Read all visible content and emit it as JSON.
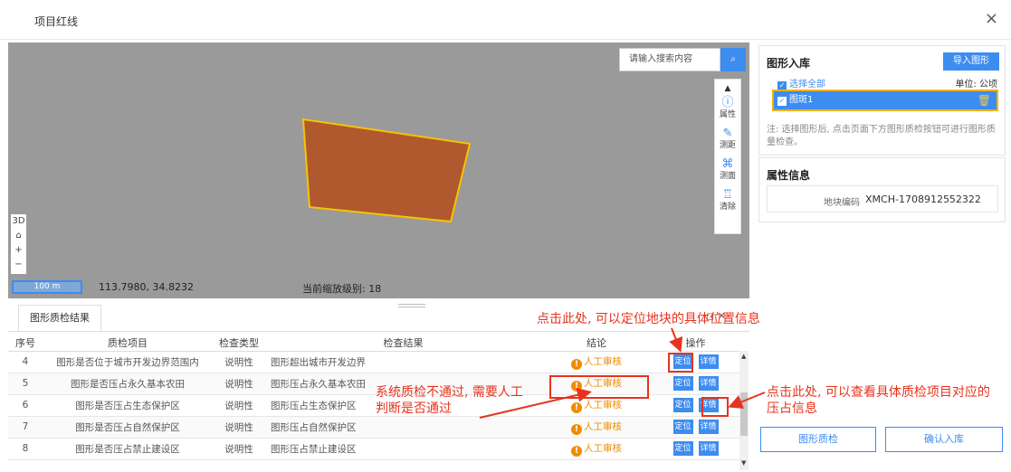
{
  "window": {
    "title": "项目红线",
    "close_label": "×"
  },
  "map": {
    "search_placeholder": "请输入搜索内容",
    "tools": [
      {
        "icon": "info-icon",
        "glyph": "ⓘ",
        "label": "属性"
      },
      {
        "icon": "pencil-icon",
        "glyph": "✎",
        "label": "测距"
      },
      {
        "icon": "area-icon",
        "glyph": "⌘",
        "label": "测面"
      },
      {
        "icon": "clear-icon",
        "glyph": "♖",
        "label": "清除"
      }
    ],
    "nav": {
      "three_d": "3D",
      "home": "🏠",
      "zoom_in": "+",
      "zoom_out": "−"
    },
    "scale_label": "100 m",
    "coordinates": "113.7980, 34.8232",
    "zoom_level_text": "当前缩放级别: 18",
    "polygon_fill": "#b0582e",
    "polygon_stroke": "#f5c400"
  },
  "right_panel": {
    "import_title": "图形入库",
    "import_button": "导入图形",
    "select_all": "选择全部",
    "unit": "单位: 公顷",
    "shape_name": "图斑1",
    "note": "注: 选择图形后, 点击页面下方图形质检按钮可进行图形质量检查。",
    "attr_title": "属性信息",
    "attr_key": "地块编码",
    "attr_value": "XMCH-1708912552322",
    "check_button": "图形质检",
    "confirm_button": "确认入库"
  },
  "bottom": {
    "tab_label": "图形质检结果",
    "columns": [
      "序号",
      "质检项目",
      "检查类型",
      "检查结果",
      "结论",
      "操作"
    ],
    "rows": [
      {
        "no": "4",
        "item": "图形是否位于城市开发边界范围内",
        "type": "说明性",
        "result": "图形超出城市开发边界",
        "conclusion": "人工审核"
      },
      {
        "no": "5",
        "item": "图形是否压占永久基本农田",
        "type": "说明性",
        "result": "图形压占永久基本农田",
        "conclusion": "人工审核"
      },
      {
        "no": "6",
        "item": "图形是否压占生态保护区",
        "type": "说明性",
        "result": "图形压占生态保护区",
        "conclusion": "人工审核"
      },
      {
        "no": "7",
        "item": "图形是否压占自然保护区",
        "type": "说明性",
        "result": "图形压占自然保护区",
        "conclusion": "人工审核"
      },
      {
        "no": "8",
        "item": "图形是否压占禁止建设区",
        "type": "说明性",
        "result": "图形压占禁止建设区",
        "conclusion": "人工审核"
      }
    ],
    "locate_label": "定位",
    "detail_label": "详情"
  },
  "annotations": {
    "locate_hint": "点击此处, 可以定位地块的具体位置信息",
    "manual_hint_line1": "系统质检不通过, 需要人工",
    "manual_hint_line2": "判断是否通过",
    "detail_hint_line1": "点击此处, 可以查看具体质检项目对应的",
    "detail_hint_line2": "压占信息",
    "color": "#e8331c"
  }
}
